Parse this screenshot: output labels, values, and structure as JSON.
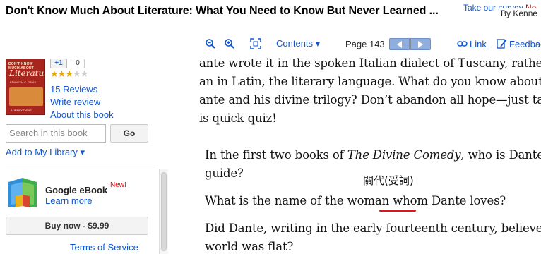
{
  "header": {
    "title": "Don't Know Much About Literature: What You Need to Know But Never Learned ...",
    "author": "By Kenne",
    "survey_link": "Take our survey",
    "survey_new": "Ne"
  },
  "sidebar": {
    "cover": {
      "line1": "DON'T KNOW MUCH ABOUT",
      "line2": "Literature",
      "line3": "KENNETH C. DAVIS",
      "line4": "& JENNY DAVIS"
    },
    "plusone_label": "+1",
    "plusone_count": "0",
    "rating": {
      "value": 3,
      "max": 5
    },
    "reviews_link": "15 Reviews",
    "write_review_link": "Write review",
    "about_link": "About this book",
    "search": {
      "placeholder": "Search in this book",
      "value": ""
    },
    "go_label": "Go",
    "add_library_link": "Add to My Library ▾",
    "ebook_title": "Google eBook",
    "ebook_new": "New!",
    "learn_more_link": "Learn more",
    "buy_label": "Buy now - $9.99",
    "tos_link": "Terms of Service"
  },
  "toolbar": {
    "zoom_out_icon": "zoom-out-icon",
    "zoom_in_icon": "zoom-in-icon",
    "fullscreen_icon": "fullscreen-icon",
    "contents_label": "Contents ▾",
    "page_label": "Page 143",
    "link_label": "Link",
    "feedback_label": "Feedbac"
  },
  "page": {
    "lines": [
      "ante wrote it in the spoken Italian dialect of Tuscany, rather",
      "an in Latin, the literary language. What do you know about",
      "ante and his divine trilogy? Don’t abandon all hope—just take",
      "is quick quiz!"
    ],
    "q1_prefix": "In the first two books of ",
    "q1_italic": "The Divine Comedy",
    "q1_suffix": ", who is Dante’s",
    "q1_line2": "guide?",
    "annotation": "關代(受詞)",
    "q2": "What is the name of the woman whom Dante loves?",
    "q3_line1": "Did Dante, writing in the early fourteenth century, believe the",
    "q3_line2": "world was flat?"
  },
  "colors": {
    "link": "#1155cc",
    "nav_button": "#8faede",
    "underline": "#e0141e",
    "star": "#e8a400"
  }
}
